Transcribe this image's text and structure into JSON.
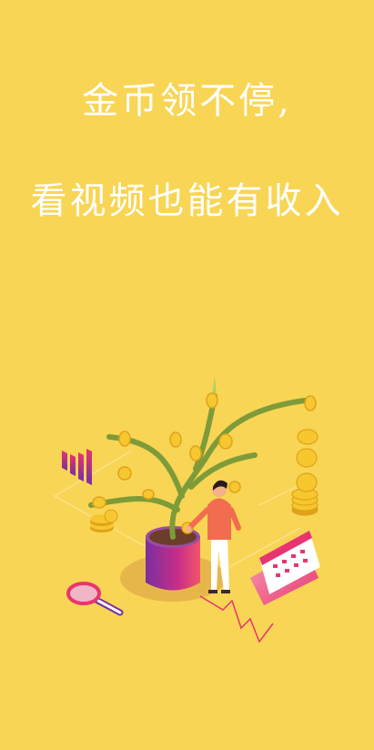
{
  "slogan": {
    "line1": "金币领不停,",
    "line2": "看视频也能有收入"
  },
  "illustration": {
    "subject": "money-tree-growth",
    "colors": {
      "background": "#F8D554",
      "coin": "#F7C72F",
      "coin_shadow": "#E0A21B",
      "magenta": "#E8356F",
      "purple": "#7A2FA0",
      "leaf_green": "#7E9B3A",
      "shirt": "#F26C4F"
    }
  }
}
